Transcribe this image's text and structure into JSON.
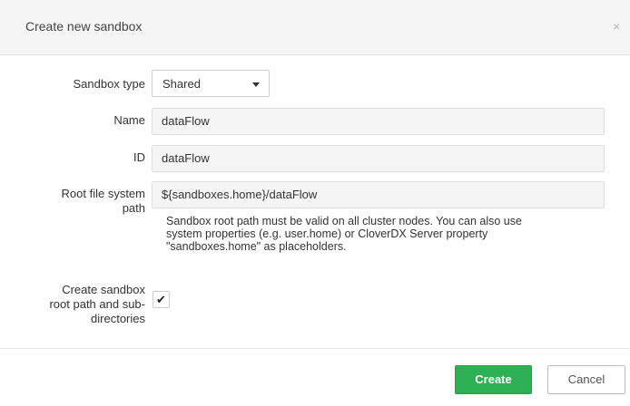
{
  "dialog": {
    "title": "Create new sandbox",
    "close_glyph": "×",
    "close_icon": "close-icon"
  },
  "form": {
    "sandbox_type": {
      "label": "Sandbox type",
      "selected": "Shared"
    },
    "name": {
      "label": "Name",
      "value": "dataFlow"
    },
    "id": {
      "label": "ID",
      "value": "dataFlow"
    },
    "root_path": {
      "label_line1": "Root file system",
      "label_line2": "path",
      "value": "${sandboxes.home}/dataFlow",
      "help_line1": "Sandbox root path must be valid on all cluster nodes. You can also use",
      "help_line2": "system properties (e.g. user.home) or CloverDX Server property",
      "help_line3": "\"sandboxes.home\" as placeholders."
    },
    "create_dirs": {
      "label_line1": "Create sandbox",
      "label_line2": "root path and sub-",
      "label_line3": "directories",
      "checked": true,
      "check_glyph": "✔"
    }
  },
  "footer": {
    "create_label": "Create",
    "cancel_label": "Cancel"
  },
  "colors": {
    "primary_button": "#2eb054",
    "header_bg": "#f5f5f5"
  }
}
